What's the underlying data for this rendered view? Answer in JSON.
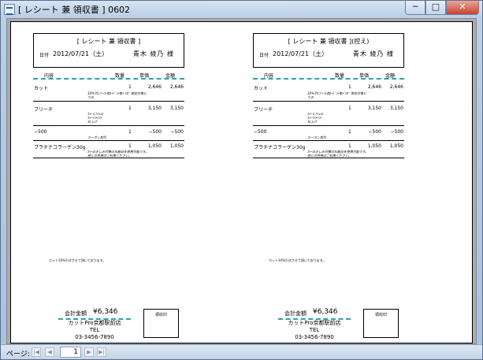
{
  "window": {
    "title": "[ レシート 兼 領収書 ] 0602",
    "minimize": "─",
    "maximize": "□",
    "close": "✕"
  },
  "receipts": [
    {
      "title": "[ レシート 兼 領収書 ]",
      "date_label": "日付",
      "date": "2012/07/21（土）",
      "customer": "青木 綾乃 様"
    },
    {
      "title": "[ レシート 兼 領収書 ](控え)",
      "date_label": "日付",
      "date": "2012/07/21（土）",
      "customer": "青木 綾乃 様"
    }
  ],
  "columns": {
    "item": "内容",
    "qty": "数量",
    "price": "単価",
    "amount": "金額"
  },
  "items": [
    {
      "name": "カット",
      "qty": "1",
      "price": "2,646",
      "amount": "2,646",
      "note": "10%引(ﾌｧｰｽﾄ割)ｲﾍﾞﾝﾄ等ﾄﾞﾛﾎﾞ 限定対象に\nつき"
    },
    {
      "name": "ブリーチ",
      "qty": "1",
      "price": "3,150",
      "amount": "3,150",
      "note": "ｶﾗｰとﾅﾁｭﾗﾙ\nｶﾗｰﾘﾌﾄﾘﾌﾄ\n仕上げ"
    },
    {
      "name": "−500",
      "qty": "1",
      "price": "−500",
      "amount": "−500",
      "note": "クーポン割引"
    },
    {
      "name": "プラチナコラーゲン30g",
      "qty": "1",
      "price": "1,050",
      "amount": "1,050",
      "note": "ｶﾗｰのきしみ対策の化粧品を使用可能です。\n他との併用はご利用ください。"
    }
  ],
  "footer": {
    "note": "カット10%引きさせて頂いております。",
    "total_label": "会計金額",
    "total_value": "¥6,346",
    "shop_name": "カットPro京都駅前店",
    "tel_label": "TEL",
    "tel": "03-3456-7890",
    "stamp_label": "領収印"
  },
  "pagebar": {
    "label": "ページ:",
    "page_number": "1",
    "first": "|◀",
    "prev": "◀",
    "next": "▶",
    "last": "▶|"
  }
}
